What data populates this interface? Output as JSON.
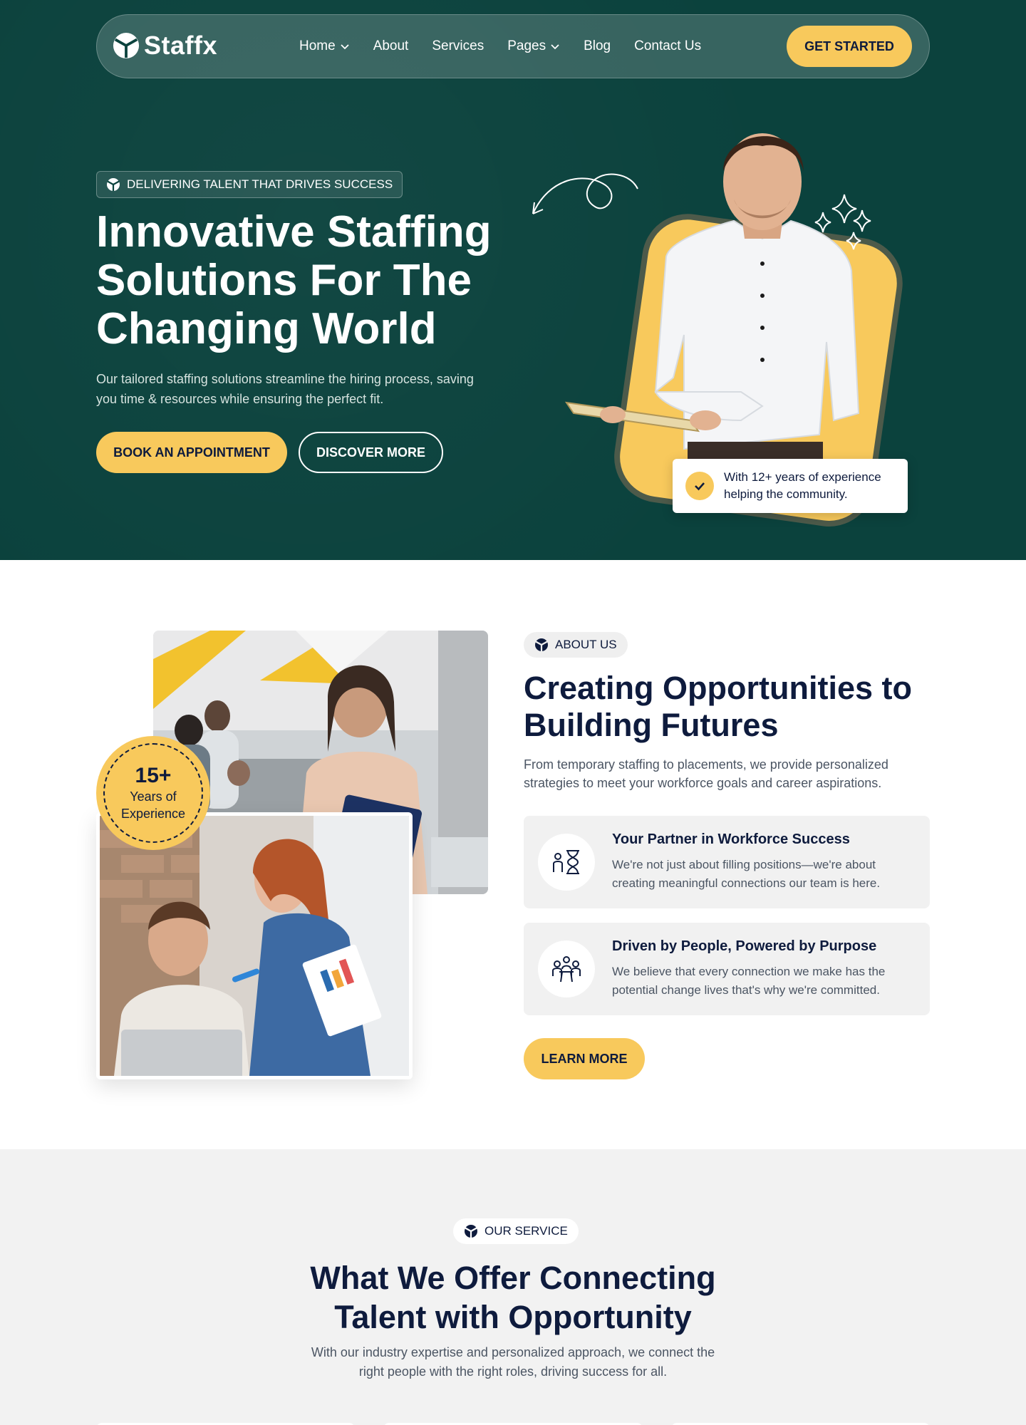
{
  "nav": {
    "brand": "Staffx",
    "links": [
      {
        "label": "Home"
      },
      {
        "label": "About"
      },
      {
        "label": "Services"
      },
      {
        "label": "Pages"
      },
      {
        "label": "Blog"
      },
      {
        "label": "Contact Us"
      }
    ],
    "cta": "GET STARTED"
  },
  "hero": {
    "badge": "DELIVERING TALENT THAT DRIVES SUCCESS",
    "title": "Innovative Staffing Solutions For The Changing World",
    "description": "Our tailored staffing solutions streamline the hiring process, saving you time & resources while ensuring the perfect fit.",
    "primary_button": "BOOK AN APPOINTMENT",
    "secondary_button": "DISCOVER MORE",
    "experience_note": "With 12+ years of experience helping the community."
  },
  "about": {
    "years_value": "15+",
    "years_label": "Years of Experience",
    "pill": "ABOUT US",
    "title": "Creating Opportunities to Building Futures",
    "description": "From temporary staffing to placements, we provide personalized strategies to meet your workforce goals and career aspirations.",
    "features": [
      {
        "title": "Your Partner in Workforce Success",
        "description": "We're not just about filling positions—we're about creating meaningful connections our team is here.",
        "icon": "hourglass-person-icon"
      },
      {
        "title": "Driven by People, Powered by Purpose",
        "description": "We believe that every connection we make has the potential change lives that's why we're committed.",
        "icon": "team-meeting-icon"
      }
    ],
    "button": "LEARN MORE"
  },
  "services": {
    "pill": "OUR SERVICE",
    "title": "What We Offer Connecting Talent with Opportunity",
    "description": "With our industry expertise and personalized approach, we connect the right people with the right roles, driving success for all."
  },
  "colors": {
    "hero_bg": "#0b423d",
    "accent": "#f8c95c",
    "heading": "#0e1b3d",
    "section_bg": "#f2f2f2"
  }
}
